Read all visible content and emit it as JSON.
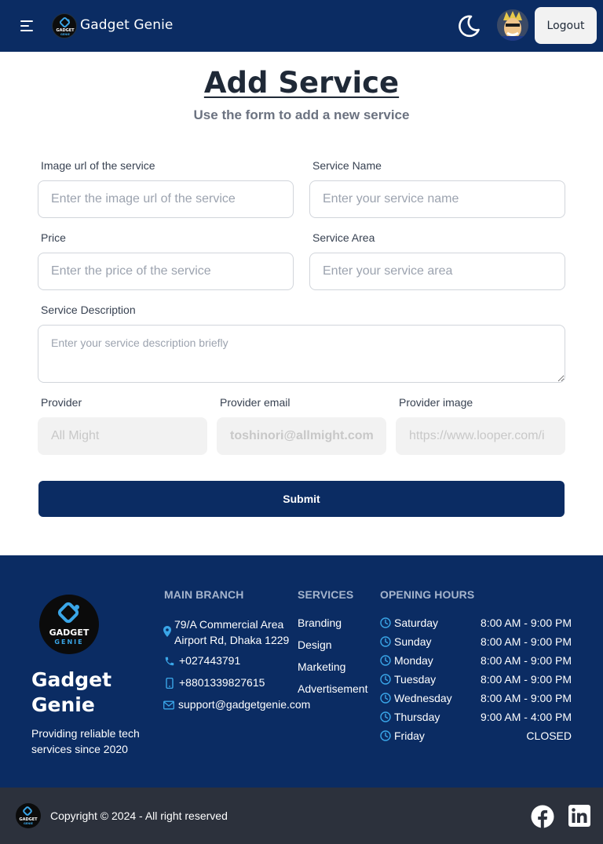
{
  "navbar": {
    "brand_name": "Gadget Genie",
    "logo_text_top": "GADGET",
    "logo_text_bottom": "GENIE",
    "logout_label": "Logout",
    "icons": [
      "menu-icon",
      "moon-icon",
      "user-avatar"
    ]
  },
  "header": {
    "title": "Add Service",
    "subtitle": "Use the form to add a new service"
  },
  "form": {
    "image_url": {
      "label": "Image url of the service",
      "placeholder": "Enter the image url of the service"
    },
    "service_name": {
      "label": "Service Name",
      "placeholder": "Enter your service name"
    },
    "price": {
      "label": "Price",
      "placeholder": "Enter the price of the service"
    },
    "service_area": {
      "label": "Service Area",
      "placeholder": "Enter your service area"
    },
    "description": {
      "label": "Service Description",
      "placeholder": "Enter your service description briefly"
    },
    "provider": {
      "label": "Provider",
      "value": "All Might"
    },
    "provider_email": {
      "label": "Provider email",
      "value": "toshinori@allmight.com"
    },
    "provider_image": {
      "label": "Provider image",
      "value": "https://www.looper.com/i"
    },
    "submit_label": "Submit"
  },
  "footer": {
    "brand_line1": "Gadget",
    "brand_line2": "Genie",
    "tagline": "Providing reliable tech services since 2020",
    "logo_text_top": "GADGET",
    "logo_text_bottom": "GENIE",
    "main_branch": {
      "title": "MAIN BRANCH",
      "address_line1": "79/A Commercial Area",
      "address_line2": "Airport Rd, Dhaka 1229",
      "phone": "+027443791",
      "mobile": "+8801339827615",
      "email": "support@gadgetgenie.com"
    },
    "services": {
      "title": "SERVICES",
      "items": [
        "Branding",
        "Design",
        "Marketing",
        "Advertisement"
      ]
    },
    "hours": {
      "title": "OPENING HOURS",
      "rows": [
        {
          "day": "Saturday",
          "time": "8:00 AM - 9:00 PM"
        },
        {
          "day": "Sunday",
          "time": "8:00 AM - 9:00 PM"
        },
        {
          "day": "Monday",
          "time": "8:00 AM - 9:00 PM"
        },
        {
          "day": "Tuesday",
          "time": "8:00 AM - 9:00 PM"
        },
        {
          "day": "Wednesday",
          "time": "8:00 AM - 9:00 PM"
        },
        {
          "day": "Thursday",
          "time": "9:00 AM - 4:00 PM"
        },
        {
          "day": "Friday",
          "time": "CLOSED"
        }
      ]
    }
  },
  "bottom_bar": {
    "copyright": "Copyright © 2024 - All right reserved",
    "social": [
      "facebook-icon",
      "linkedin-icon"
    ]
  },
  "colors": {
    "primary": "#0b2c63",
    "footer_heading": "#a5b4cc",
    "icon_accent": "#3aa6e8",
    "bottom_bar": "#2c313c"
  }
}
